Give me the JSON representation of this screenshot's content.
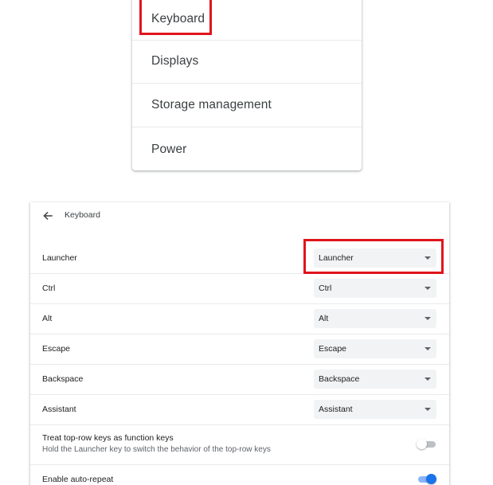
{
  "menu": {
    "items": [
      {
        "label": "Keyboard"
      },
      {
        "label": "Displays"
      },
      {
        "label": "Storage management"
      },
      {
        "label": "Power"
      }
    ]
  },
  "keyboard": {
    "title": "Keyboard",
    "rows": [
      {
        "label": "Launcher",
        "value": "Launcher"
      },
      {
        "label": "Ctrl",
        "value": "Ctrl"
      },
      {
        "label": "Alt",
        "value": "Alt"
      },
      {
        "label": "Escape",
        "value": "Escape"
      },
      {
        "label": "Backspace",
        "value": "Backspace"
      },
      {
        "label": "Assistant",
        "value": "Assistant"
      }
    ],
    "top_row": {
      "label": "Treat top-row keys as function keys",
      "sublabel": "Hold the Launcher key to switch the behavior of the top-row keys",
      "enabled": false
    },
    "auto_repeat": {
      "label": "Enable auto-repeat",
      "enabled": true
    }
  },
  "colors": {
    "highlight": "#e0151c",
    "accent": "#1a73e8"
  },
  "icons": {
    "back": "arrow-back-icon",
    "dropdown": "caret-down-icon"
  }
}
